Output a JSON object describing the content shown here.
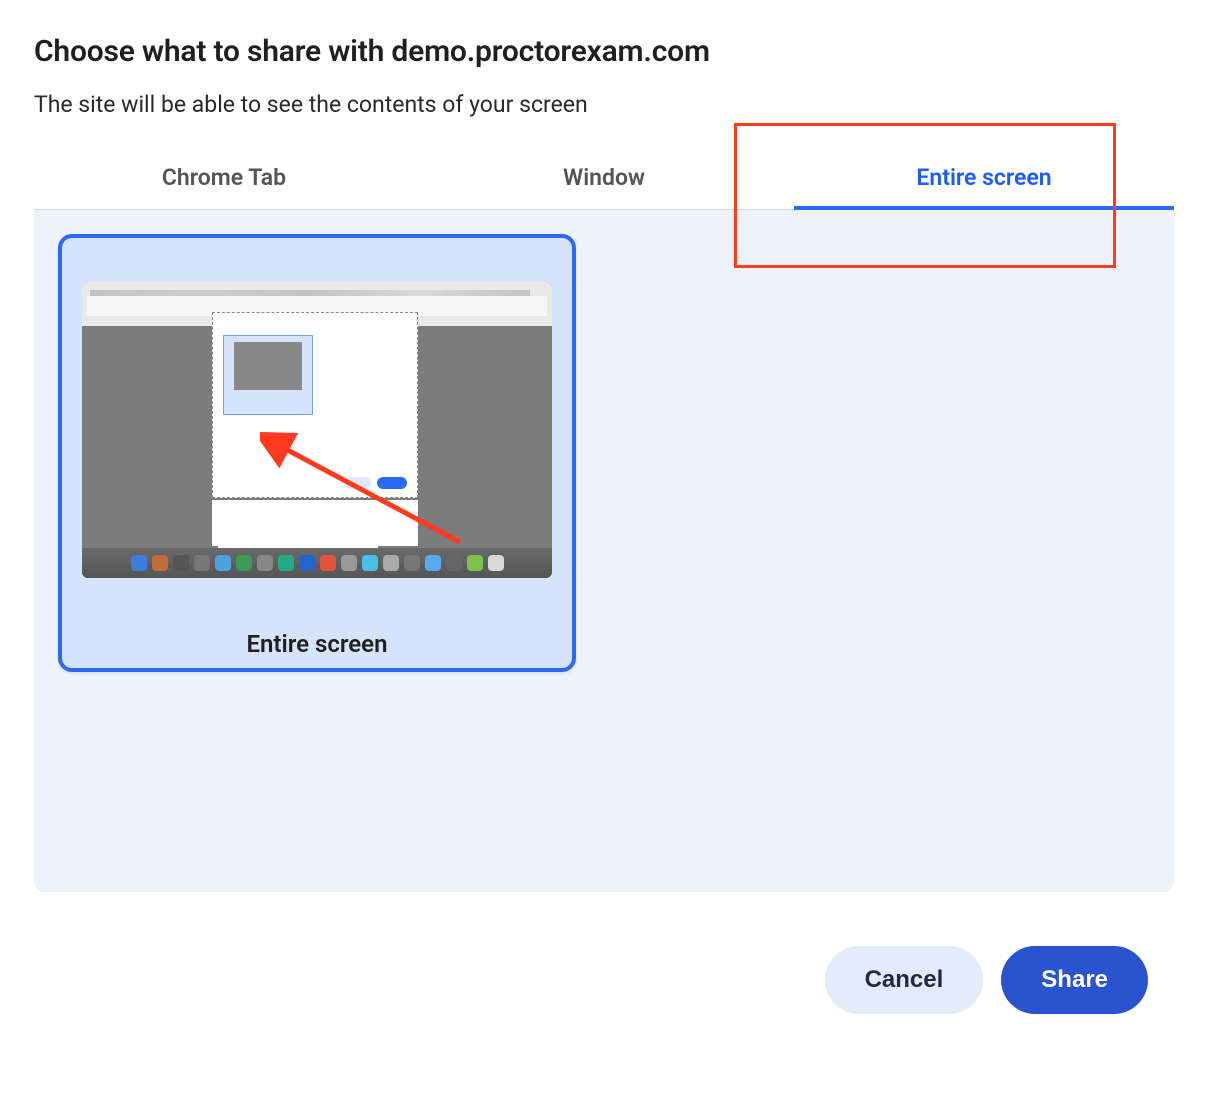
{
  "dialog": {
    "title": "Choose what to share with demo.proctorexam.com",
    "subtitle": "The site will be able to see the contents of your screen"
  },
  "tabs": {
    "items": [
      {
        "label": "Chrome Tab",
        "active": false
      },
      {
        "label": "Window",
        "active": false
      },
      {
        "label": "Entire screen",
        "active": true
      }
    ]
  },
  "selection": {
    "thumbnail_label": "Entire screen"
  },
  "footer": {
    "cancel_label": "Cancel",
    "share_label": "Share"
  },
  "annotations": {
    "highlight_tab": "Entire screen",
    "arrow_target": "screen-thumbnail"
  }
}
